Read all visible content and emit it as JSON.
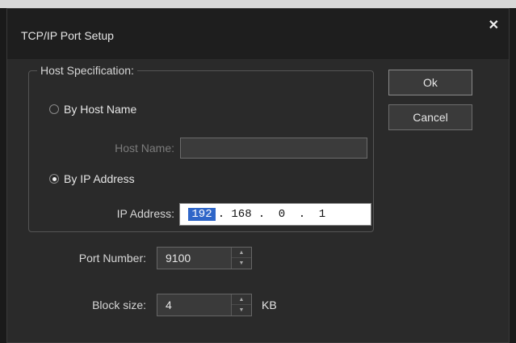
{
  "dialog": {
    "title": "TCP/IP Port Setup",
    "close_glyph": "✕"
  },
  "host_group": {
    "legend": "Host Specification:",
    "by_host_name": {
      "label": "By Host Name",
      "checked": false
    },
    "host_name": {
      "label": "Host Name:",
      "value": ""
    },
    "by_ip": {
      "label": "By IP Address",
      "checked": true
    },
    "ip": {
      "label": "IP Address:",
      "octets": [
        "192",
        "168",
        "0",
        "1"
      ],
      "separator": "."
    }
  },
  "buttons": {
    "ok": "Ok",
    "cancel": "Cancel"
  },
  "port": {
    "label": "Port Number:",
    "value": "9100"
  },
  "block": {
    "label": "Block size:",
    "value": "4",
    "unit": "KB"
  },
  "colors": {
    "selection": "#2f66c8",
    "dialog_bg": "#2a2a2a"
  }
}
